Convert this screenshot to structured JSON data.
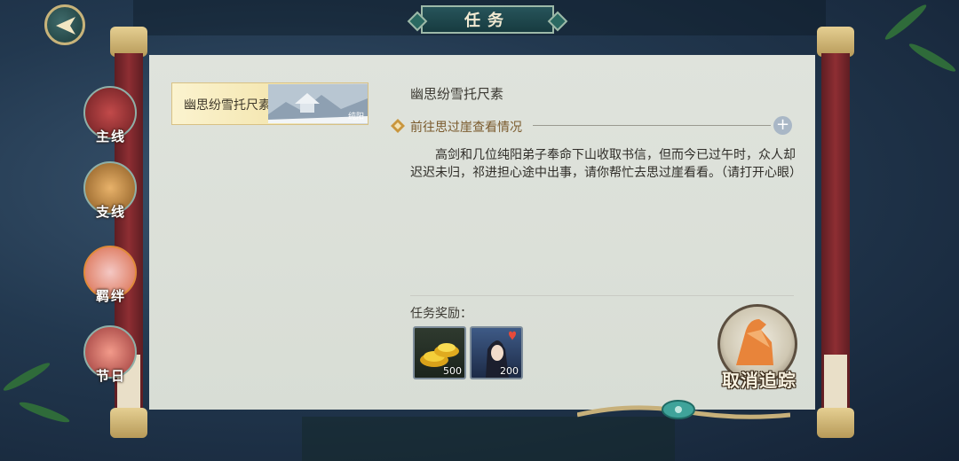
{
  "window": {
    "title": "任务"
  },
  "categories": [
    {
      "label": "主线",
      "icon": "dragon-icon"
    },
    {
      "label": "支线",
      "icon": "tiger-icon"
    },
    {
      "label": "羁绊",
      "icon": "lotus-bird-icon"
    },
    {
      "label": "节日",
      "icon": "fish-icon"
    }
  ],
  "quest_list": [
    {
      "name": "幽思纷雪托尺素",
      "tag": "纯阳",
      "selected": true
    }
  ],
  "detail": {
    "title": "幽思纷雪托尺素",
    "objective": "前往思过崖查看情况",
    "description": "　　高剑和几位纯阳弟子奉命下山收取书信，但而今已过午时，众人却迟迟未归，祁进担心途中出事，请你帮忙去思过崖看看。（请打开心眼）"
  },
  "rewards": {
    "label": "任务奖励：",
    "items": [
      {
        "icon": "gold-ingot-icon",
        "count": "500"
      },
      {
        "icon": "character-affection-icon",
        "count": "200"
      }
    ]
  },
  "cancel_tracking": {
    "label": "取消追踪"
  },
  "colors": {
    "pillar": "#8e2e33",
    "scroll": "#dfe3dc",
    "accent": "#c8b37a"
  }
}
